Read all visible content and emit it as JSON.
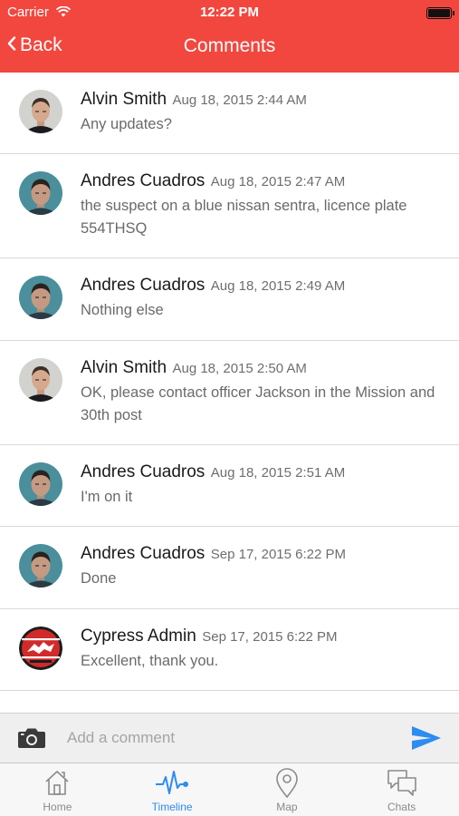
{
  "status_bar": {
    "carrier": "Carrier",
    "time": "12:22 PM"
  },
  "nav": {
    "back_label": "Back",
    "title": "Comments"
  },
  "comments": [
    {
      "author": "Alvin Smith",
      "date": "Aug 18, 2015 2:44 AM",
      "text": "Any updates?",
      "avatar": "officer-photo"
    },
    {
      "author": "Andres Cuadros",
      "date": "Aug 18, 2015 2:47 AM",
      "text": "the suspect on a blue nissan sentra, licence plate 554THSQ",
      "avatar": "man-photo"
    },
    {
      "author": "Andres Cuadros",
      "date": "Aug 18, 2015 2:49 AM",
      "text": "Nothing else",
      "avatar": "man-photo"
    },
    {
      "author": "Alvin Smith",
      "date": "Aug 18, 2015 2:50 AM",
      "text": "OK, please contact officer Jackson in the Mission and 30th post",
      "avatar": "officer-photo"
    },
    {
      "author": "Andres Cuadros",
      "date": "Aug 18, 2015 2:51 AM",
      "text": "I'm on it",
      "avatar": "man-photo"
    },
    {
      "author": "Andres Cuadros",
      "date": "Sep 17, 2015 6:22 PM",
      "text": "Done",
      "avatar": "man-photo"
    },
    {
      "author": "Cypress Admin",
      "date": "Sep 17, 2015 6:22 PM",
      "text": "Excellent, thank you.",
      "avatar": "cypress-logo"
    }
  ],
  "composer": {
    "placeholder": "Add a comment"
  },
  "tabs": [
    {
      "label": "Home",
      "icon": "home-icon"
    },
    {
      "label": "Timeline",
      "icon": "pulse-icon",
      "active": true
    },
    {
      "label": "Map",
      "icon": "map-pin-icon"
    },
    {
      "label": "Chats",
      "icon": "chat-bubbles-icon"
    }
  ],
  "colors": {
    "header": "#f2473f",
    "accent": "#2d8cf0",
    "tab_inactive": "#8a8a8a"
  }
}
